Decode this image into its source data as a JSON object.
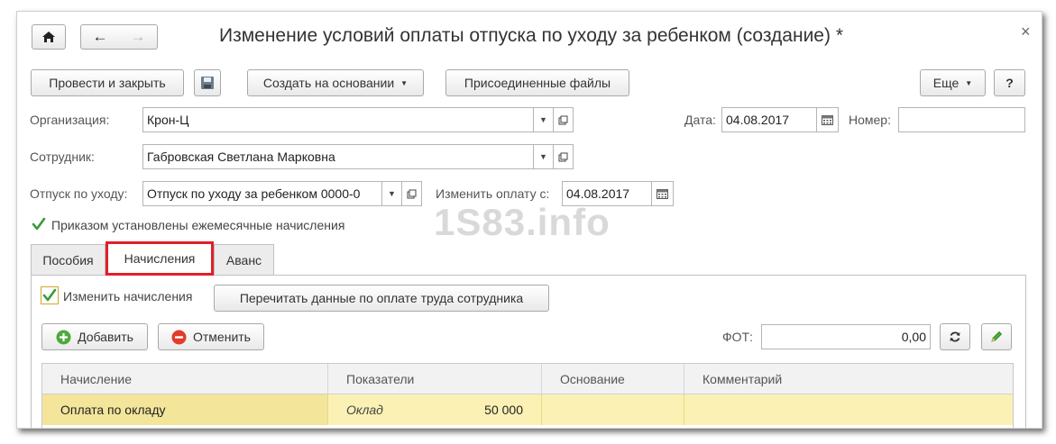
{
  "window": {
    "title": "Изменение условий оплаты отпуска по уходу за ребенком (создание) *",
    "close_glyph": "×"
  },
  "toolbar": {
    "post_close": "Провести и закрыть",
    "create_based": "Создать на основании",
    "attached_files": "Присоединенные файлы",
    "more": "Еще",
    "help": "?"
  },
  "form": {
    "org_label": "Организация:",
    "org_value": "Крон-Ц",
    "date_label": "Дата:",
    "date_value": "04.08.2017",
    "number_label": "Номер:",
    "number_value": "",
    "employee_label": "Сотрудник:",
    "employee_value": "Габровская Светлана Марковна",
    "leave_label": "Отпуск по уходу:",
    "leave_value": "Отпуск по уходу за ребенком 0000-0",
    "change_pay_label": "Изменить оплату с:",
    "change_pay_value": "04.08.2017",
    "monthly_accruals_label": "Приказом установлены ежемесячные начисления"
  },
  "watermark": "1S83.info",
  "tabs": [
    {
      "label": "Пособия"
    },
    {
      "label": "Начисления"
    },
    {
      "label": "Аванс"
    }
  ],
  "accruals": {
    "change_label": "Изменить начисления",
    "reread_button": "Перечитать данные по оплате труда сотрудника",
    "add_button": "Добавить",
    "cancel_button": "Отменить",
    "fot_label": "ФОТ:",
    "fot_value": "0,00"
  },
  "table": {
    "headers": [
      "Начисление",
      "Показатели",
      "Основание",
      "Комментарий"
    ],
    "rows": [
      {
        "accrual": "Оплата по окладу",
        "indicator": "Оклад",
        "amount": "50 000",
        "basis": "",
        "comment": ""
      }
    ]
  },
  "colors": {
    "accent_red": "#e0202a",
    "check_green": "#3a9a3a",
    "row_highlight": "#fbf1b4",
    "row_highlight_dark": "#f3e59a"
  }
}
